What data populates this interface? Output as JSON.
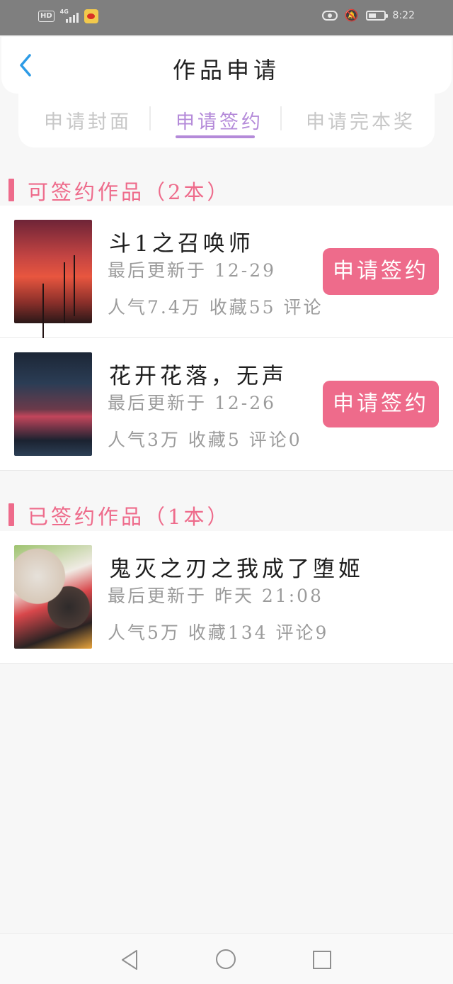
{
  "status_bar": {
    "hd": "HD",
    "network": "4G",
    "time": "8:22"
  },
  "header": {
    "title": "作品申请"
  },
  "tabs": [
    {
      "label": "申请封面",
      "active": false
    },
    {
      "label": "申请签约",
      "active": true
    },
    {
      "label": "申请完本奖",
      "active": false
    }
  ],
  "sections": {
    "signable": {
      "title": "可签约作品（2本）",
      "books": [
        {
          "title": "斗1之召唤师",
          "updated": "最后更新于 12-29",
          "stats": "人气7.4万 收藏55 评论",
          "button": "申请签约"
        },
        {
          "title": "花开花落，无声",
          "updated": "最后更新于 12-26",
          "stats": "人气3万 收藏5 评论0",
          "button": "申请签约"
        }
      ]
    },
    "signed": {
      "title": "已签约作品（1本）",
      "books": [
        {
          "title": "鬼灭之刃之我成了堕姬",
          "updated": "最后更新于 昨天 21:08",
          "stats": "人气5万 收藏134 评论9"
        }
      ]
    }
  },
  "colors": {
    "accent_pink": "#ee6b8b",
    "accent_purple": "#b48ad9",
    "back_blue": "#2d9be6"
  }
}
